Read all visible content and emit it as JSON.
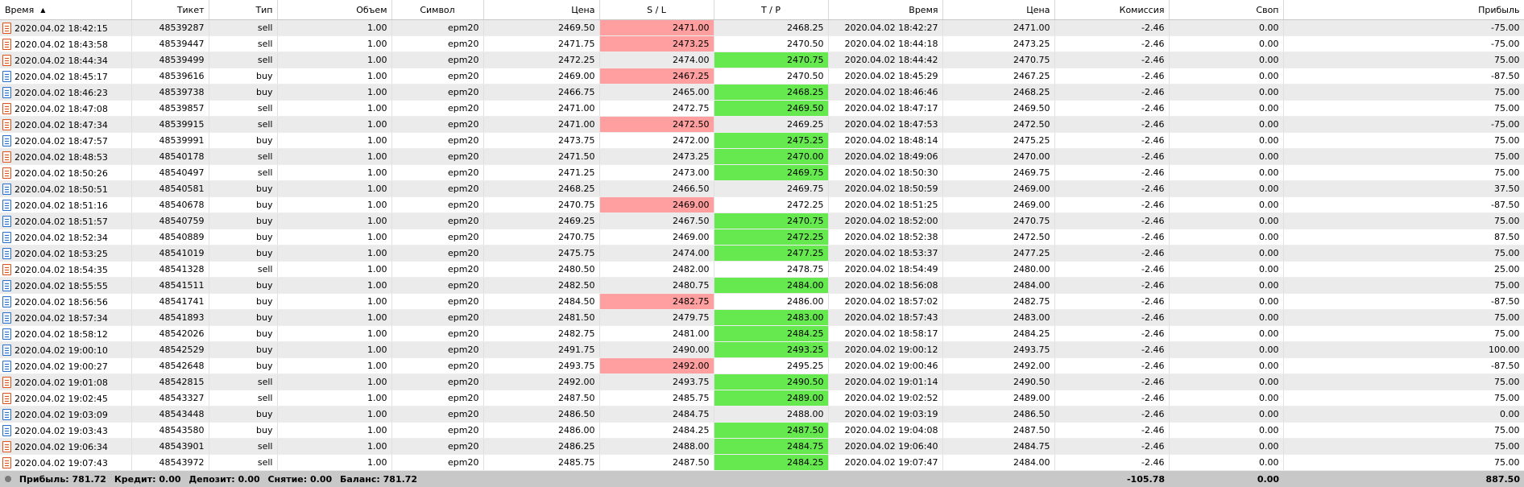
{
  "columns": [
    {
      "key": "open_time",
      "label": "Время"
    },
    {
      "key": "ticket",
      "label": "Тикет"
    },
    {
      "key": "type",
      "label": "Тип"
    },
    {
      "key": "volume",
      "label": "Объем"
    },
    {
      "key": "symbol",
      "label": "Символ"
    },
    {
      "key": "price",
      "label": "Цена"
    },
    {
      "key": "sl",
      "label": "S / L"
    },
    {
      "key": "tp",
      "label": "T / P"
    },
    {
      "key": "close_time",
      "label": "Время"
    },
    {
      "key": "close_price",
      "label": "Цена"
    },
    {
      "key": "commission",
      "label": "Комиссия"
    },
    {
      "key": "swap",
      "label": "Своп"
    },
    {
      "key": "profit",
      "label": "Прибыль"
    }
  ],
  "sort_indicator": "▲",
  "colors": {
    "sl_hit": "#ff9f9f",
    "tp_hit": "#66e84f",
    "buy_icon": "#2c6fc9",
    "sell_icon": "#d9541e",
    "row_alt": "#ebebeb"
  },
  "rows": [
    {
      "open_time": "2020.04.02 18:42:15",
      "ticket": "48539287",
      "type": "sell",
      "volume": "1.00",
      "symbol": "epm20",
      "price": "2469.50",
      "sl": "2471.00",
      "tp": "2468.25",
      "close_time": "2020.04.02 18:42:27",
      "close_price": "2471.00",
      "commission": "-2.46",
      "swap": "0.00",
      "profit": "-75.00",
      "hit": "sl"
    },
    {
      "open_time": "2020.04.02 18:43:58",
      "ticket": "48539447",
      "type": "sell",
      "volume": "1.00",
      "symbol": "epm20",
      "price": "2471.75",
      "sl": "2473.25",
      "tp": "2470.50",
      "close_time": "2020.04.02 18:44:18",
      "close_price": "2473.25",
      "commission": "-2.46",
      "swap": "0.00",
      "profit": "-75.00",
      "hit": "sl"
    },
    {
      "open_time": "2020.04.02 18:44:34",
      "ticket": "48539499",
      "type": "sell",
      "volume": "1.00",
      "symbol": "epm20",
      "price": "2472.25",
      "sl": "2474.00",
      "tp": "2470.75",
      "close_time": "2020.04.02 18:44:42",
      "close_price": "2470.75",
      "commission": "-2.46",
      "swap": "0.00",
      "profit": "75.00",
      "hit": "tp"
    },
    {
      "open_time": "2020.04.02 18:45:17",
      "ticket": "48539616",
      "type": "buy",
      "volume": "1.00",
      "symbol": "epm20",
      "price": "2469.00",
      "sl": "2467.25",
      "tp": "2470.50",
      "close_time": "2020.04.02 18:45:29",
      "close_price": "2467.25",
      "commission": "-2.46",
      "swap": "0.00",
      "profit": "-87.50",
      "hit": "sl"
    },
    {
      "open_time": "2020.04.02 18:46:23",
      "ticket": "48539738",
      "type": "buy",
      "volume": "1.00",
      "symbol": "epm20",
      "price": "2466.75",
      "sl": "2465.00",
      "tp": "2468.25",
      "close_time": "2020.04.02 18:46:46",
      "close_price": "2468.25",
      "commission": "-2.46",
      "swap": "0.00",
      "profit": "75.00",
      "hit": "tp"
    },
    {
      "open_time": "2020.04.02 18:47:08",
      "ticket": "48539857",
      "type": "sell",
      "volume": "1.00",
      "symbol": "epm20",
      "price": "2471.00",
      "sl": "2472.75",
      "tp": "2469.50",
      "close_time": "2020.04.02 18:47:17",
      "close_price": "2469.50",
      "commission": "-2.46",
      "swap": "0.00",
      "profit": "75.00",
      "hit": "tp"
    },
    {
      "open_time": "2020.04.02 18:47:34",
      "ticket": "48539915",
      "type": "sell",
      "volume": "1.00",
      "symbol": "epm20",
      "price": "2471.00",
      "sl": "2472.50",
      "tp": "2469.25",
      "close_time": "2020.04.02 18:47:53",
      "close_price": "2472.50",
      "commission": "-2.46",
      "swap": "0.00",
      "profit": "-75.00",
      "hit": "sl"
    },
    {
      "open_time": "2020.04.02 18:47:57",
      "ticket": "48539991",
      "type": "buy",
      "volume": "1.00",
      "symbol": "epm20",
      "price": "2473.75",
      "sl": "2472.00",
      "tp": "2475.25",
      "close_time": "2020.04.02 18:48:14",
      "close_price": "2475.25",
      "commission": "-2.46",
      "swap": "0.00",
      "profit": "75.00",
      "hit": "tp"
    },
    {
      "open_time": "2020.04.02 18:48:53",
      "ticket": "48540178",
      "type": "sell",
      "volume": "1.00",
      "symbol": "epm20",
      "price": "2471.50",
      "sl": "2473.25",
      "tp": "2470.00",
      "close_time": "2020.04.02 18:49:06",
      "close_price": "2470.00",
      "commission": "-2.46",
      "swap": "0.00",
      "profit": "75.00",
      "hit": "tp"
    },
    {
      "open_time": "2020.04.02 18:50:26",
      "ticket": "48540497",
      "type": "sell",
      "volume": "1.00",
      "symbol": "epm20",
      "price": "2471.25",
      "sl": "2473.00",
      "tp": "2469.75",
      "close_time": "2020.04.02 18:50:30",
      "close_price": "2469.75",
      "commission": "-2.46",
      "swap": "0.00",
      "profit": "75.00",
      "hit": "tp"
    },
    {
      "open_time": "2020.04.02 18:50:51",
      "ticket": "48540581",
      "type": "buy",
      "volume": "1.00",
      "symbol": "epm20",
      "price": "2468.25",
      "sl": "2466.50",
      "tp": "2469.75",
      "close_time": "2020.04.02 18:50:59",
      "close_price": "2469.00",
      "commission": "-2.46",
      "swap": "0.00",
      "profit": "37.50",
      "hit": ""
    },
    {
      "open_time": "2020.04.02 18:51:16",
      "ticket": "48540678",
      "type": "buy",
      "volume": "1.00",
      "symbol": "epm20",
      "price": "2470.75",
      "sl": "2469.00",
      "tp": "2472.25",
      "close_time": "2020.04.02 18:51:25",
      "close_price": "2469.00",
      "commission": "-2.46",
      "swap": "0.00",
      "profit": "-87.50",
      "hit": "sl"
    },
    {
      "open_time": "2020.04.02 18:51:57",
      "ticket": "48540759",
      "type": "buy",
      "volume": "1.00",
      "symbol": "epm20",
      "price": "2469.25",
      "sl": "2467.50",
      "tp": "2470.75",
      "close_time": "2020.04.02 18:52:00",
      "close_price": "2470.75",
      "commission": "-2.46",
      "swap": "0.00",
      "profit": "75.00",
      "hit": "tp"
    },
    {
      "open_time": "2020.04.02 18:52:34",
      "ticket": "48540889",
      "type": "buy",
      "volume": "1.00",
      "symbol": "epm20",
      "price": "2470.75",
      "sl": "2469.00",
      "tp": "2472.25",
      "close_time": "2020.04.02 18:52:38",
      "close_price": "2472.50",
      "commission": "-2.46",
      "swap": "0.00",
      "profit": "87.50",
      "hit": "tp"
    },
    {
      "open_time": "2020.04.02 18:53:25",
      "ticket": "48541019",
      "type": "buy",
      "volume": "1.00",
      "symbol": "epm20",
      "price": "2475.75",
      "sl": "2474.00",
      "tp": "2477.25",
      "close_time": "2020.04.02 18:53:37",
      "close_price": "2477.25",
      "commission": "-2.46",
      "swap": "0.00",
      "profit": "75.00",
      "hit": "tp"
    },
    {
      "open_time": "2020.04.02 18:54:35",
      "ticket": "48541328",
      "type": "sell",
      "volume": "1.00",
      "symbol": "epm20",
      "price": "2480.50",
      "sl": "2482.00",
      "tp": "2478.75",
      "close_time": "2020.04.02 18:54:49",
      "close_price": "2480.00",
      "commission": "-2.46",
      "swap": "0.00",
      "profit": "25.00",
      "hit": ""
    },
    {
      "open_time": "2020.04.02 18:55:55",
      "ticket": "48541511",
      "type": "buy",
      "volume": "1.00",
      "symbol": "epm20",
      "price": "2482.50",
      "sl": "2480.75",
      "tp": "2484.00",
      "close_time": "2020.04.02 18:56:08",
      "close_price": "2484.00",
      "commission": "-2.46",
      "swap": "0.00",
      "profit": "75.00",
      "hit": "tp"
    },
    {
      "open_time": "2020.04.02 18:56:56",
      "ticket": "48541741",
      "type": "buy",
      "volume": "1.00",
      "symbol": "epm20",
      "price": "2484.50",
      "sl": "2482.75",
      "tp": "2486.00",
      "close_time": "2020.04.02 18:57:02",
      "close_price": "2482.75",
      "commission": "-2.46",
      "swap": "0.00",
      "profit": "-87.50",
      "hit": "sl"
    },
    {
      "open_time": "2020.04.02 18:57:34",
      "ticket": "48541893",
      "type": "buy",
      "volume": "1.00",
      "symbol": "epm20",
      "price": "2481.50",
      "sl": "2479.75",
      "tp": "2483.00",
      "close_time": "2020.04.02 18:57:43",
      "close_price": "2483.00",
      "commission": "-2.46",
      "swap": "0.00",
      "profit": "75.00",
      "hit": "tp"
    },
    {
      "open_time": "2020.04.02 18:58:12",
      "ticket": "48542026",
      "type": "buy",
      "volume": "1.00",
      "symbol": "epm20",
      "price": "2482.75",
      "sl": "2481.00",
      "tp": "2484.25",
      "close_time": "2020.04.02 18:58:17",
      "close_price": "2484.25",
      "commission": "-2.46",
      "swap": "0.00",
      "profit": "75.00",
      "hit": "tp"
    },
    {
      "open_time": "2020.04.02 19:00:10",
      "ticket": "48542529",
      "type": "buy",
      "volume": "1.00",
      "symbol": "epm20",
      "price": "2491.75",
      "sl": "2490.00",
      "tp": "2493.25",
      "close_time": "2020.04.02 19:00:12",
      "close_price": "2493.75",
      "commission": "-2.46",
      "swap": "0.00",
      "profit": "100.00",
      "hit": "tp"
    },
    {
      "open_time": "2020.04.02 19:00:27",
      "ticket": "48542648",
      "type": "buy",
      "volume": "1.00",
      "symbol": "epm20",
      "price": "2493.75",
      "sl": "2492.00",
      "tp": "2495.25",
      "close_time": "2020.04.02 19:00:46",
      "close_price": "2492.00",
      "commission": "-2.46",
      "swap": "0.00",
      "profit": "-87.50",
      "hit": "sl"
    },
    {
      "open_time": "2020.04.02 19:01:08",
      "ticket": "48542815",
      "type": "sell",
      "volume": "1.00",
      "symbol": "epm20",
      "price": "2492.00",
      "sl": "2493.75",
      "tp": "2490.50",
      "close_time": "2020.04.02 19:01:14",
      "close_price": "2490.50",
      "commission": "-2.46",
      "swap": "0.00",
      "profit": "75.00",
      "hit": "tp"
    },
    {
      "open_time": "2020.04.02 19:02:45",
      "ticket": "48543327",
      "type": "sell",
      "volume": "1.00",
      "symbol": "epm20",
      "price": "2487.50",
      "sl": "2485.75",
      "tp": "2489.00",
      "close_time": "2020.04.02 19:02:52",
      "close_price": "2489.00",
      "commission": "-2.46",
      "swap": "0.00",
      "profit": "75.00",
      "hit": "tp"
    },
    {
      "open_time": "2020.04.02 19:03:09",
      "ticket": "48543448",
      "type": "buy",
      "volume": "1.00",
      "symbol": "epm20",
      "price": "2486.50",
      "sl": "2484.75",
      "tp": "2488.00",
      "close_time": "2020.04.02 19:03:19",
      "close_price": "2486.50",
      "commission": "-2.46",
      "swap": "0.00",
      "profit": "0.00",
      "hit": ""
    },
    {
      "open_time": "2020.04.02 19:03:43",
      "ticket": "48543580",
      "type": "buy",
      "volume": "1.00",
      "symbol": "epm20",
      "price": "2486.00",
      "sl": "2484.25",
      "tp": "2487.50",
      "close_time": "2020.04.02 19:04:08",
      "close_price": "2487.50",
      "commission": "-2.46",
      "swap": "0.00",
      "profit": "75.00",
      "hit": "tp"
    },
    {
      "open_time": "2020.04.02 19:06:34",
      "ticket": "48543901",
      "type": "sell",
      "volume": "1.00",
      "symbol": "epm20",
      "price": "2486.25",
      "sl": "2488.00",
      "tp": "2484.75",
      "close_time": "2020.04.02 19:06:40",
      "close_price": "2484.75",
      "commission": "-2.46",
      "swap": "0.00",
      "profit": "75.00",
      "hit": "tp"
    },
    {
      "open_time": "2020.04.02 19:07:43",
      "ticket": "48543972",
      "type": "sell",
      "volume": "1.00",
      "symbol": "epm20",
      "price": "2485.75",
      "sl": "2487.50",
      "tp": "2484.25",
      "close_time": "2020.04.02 19:07:47",
      "close_price": "2484.00",
      "commission": "-2.46",
      "swap": "0.00",
      "profit": "75.00",
      "hit": "tp"
    }
  ],
  "footer": {
    "profit_label": "Прибыль:",
    "profit": "781.72",
    "credit_label": "Кредит:",
    "credit": "0.00",
    "deposit_label": "Депозит:",
    "deposit": "0.00",
    "withdrawal_label": "Снятие:",
    "withdrawal": "0.00",
    "balance_label": "Баланс:",
    "balance": "781.72",
    "commission_total": "-105.78",
    "swap_total": "0.00",
    "profit_total": "887.50"
  }
}
